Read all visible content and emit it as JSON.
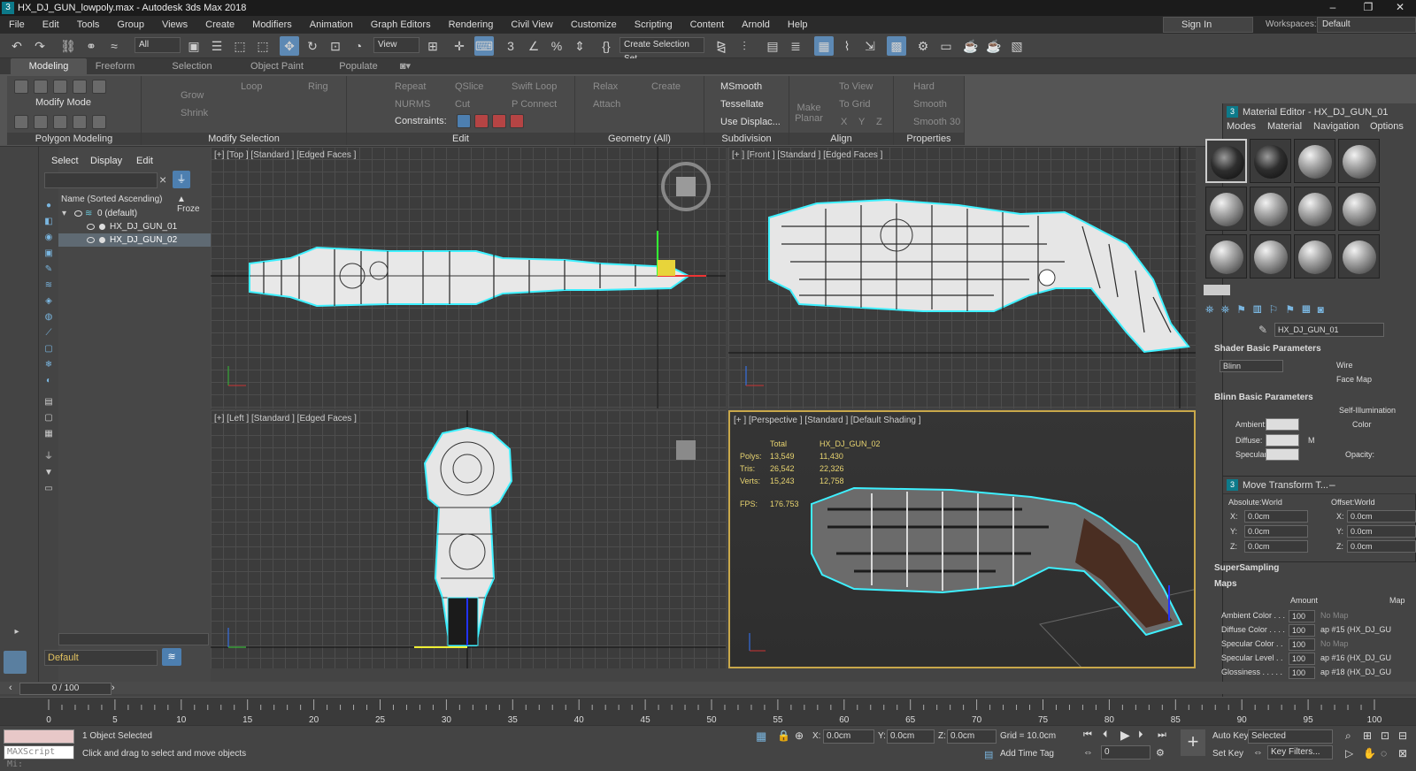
{
  "title": "HX_DJ_GUN_lowpoly.max - Autodesk 3ds Max 2018",
  "menu": [
    "File",
    "Edit",
    "Tools",
    "Group",
    "Views",
    "Create",
    "Modifiers",
    "Animation",
    "Graph Editors",
    "Rendering",
    "Civil View",
    "Customize",
    "Scripting",
    "Content",
    "Arnold",
    "Help"
  ],
  "signin": "Sign In",
  "workspaces_label": "Workspaces:",
  "workspaces_value": "Default",
  "toolbar": {
    "filter": "All",
    "view": "View",
    "selset": "Create Selection Set"
  },
  "ribbon_tabs": [
    "Modeling",
    "Freeform",
    "Selection",
    "Object Paint",
    "Populate"
  ],
  "ribbon": {
    "modify_mode": "Modify Mode",
    "poly": "Polygon Modeling",
    "grow": "Grow",
    "shrink": "Shrink",
    "loop": "Loop",
    "ring": "Ring",
    "modsel": "Modify Selection",
    "repeat": "Repeat",
    "qslice": "QSlice",
    "swiftloop": "Swift Loop",
    "nurms": "NURMS",
    "cut": "Cut",
    "pconnect": "P Connect",
    "constraints": "Constraints:",
    "edit": "Edit",
    "relax": "Relax",
    "create": "Create",
    "attach": "Attach",
    "geometry": "Geometry (All)",
    "msmooth": "MSmooth",
    "tessellate": "Tessellate",
    "usedisplac": "Use Displac...",
    "subdivision": "Subdivision",
    "makeplanar": "Make Planar",
    "align": "Align",
    "x": "X",
    "y": "Y",
    "z": "Z",
    "toview": "To View",
    "togrid": "To Grid",
    "hard": "Hard",
    "smooth": "Smooth",
    "smooth30": "Smooth 30",
    "properties": "Properties"
  },
  "scene": {
    "tabs": [
      "Select",
      "Display",
      "Edit"
    ],
    "col": "Name (Sorted Ascending)",
    "froze": "▲ Froze",
    "layer": "0 (default)",
    "items": [
      "HX_DJ_GUN_01",
      "HX_DJ_GUN_02"
    ],
    "layer_bottom": "Default"
  },
  "viewports": {
    "top": "[+] [Top ] [Standard ] [Edged Faces ]",
    "front": "[+ ] [Front ] [Standard ] [Edged Faces ]",
    "left": "[+] [Left ] [Standard ] [Edged Faces ]",
    "persp": "[+ ] [Perspective ] [Standard ] [Default Shading ]"
  },
  "stats": {
    "total": "Total",
    "obj": "HX_DJ_GUN_02",
    "polys": "Polys:",
    "tris": "Tris:",
    "verts": "Verts:",
    "polys_t": "13,549",
    "polys_o": "11,430",
    "tris_t": "26,542",
    "tris_o": "22,326",
    "verts_t": "15,243",
    "verts_o": "12,758",
    "fps": "FPS:",
    "fps_v": "176.753"
  },
  "mat": {
    "title": "Material Editor - HX_DJ_GUN_01",
    "menu": [
      "Modes",
      "Material",
      "Navigation",
      "Options"
    ],
    "name": "HX_DJ_GUN_01",
    "shader_hdr": "Shader Basic Parameters",
    "shader": "Blinn",
    "wire": "Wire",
    "facemap": "Face Map",
    "blinn_hdr": "Blinn Basic Parameters",
    "selfillum": "Self-Illumination",
    "color": "Color",
    "ambient": "Ambient:",
    "diffuse": "Diffuse:",
    "specular": "Specular:",
    "opacity": "Opacity:",
    "m": "M",
    "supersampling": "SuperSampling",
    "maps": "Maps",
    "amount": "Amount",
    "map": "Map",
    "maprows": [
      {
        "label": "Ambient Color . . .",
        "amt": "100",
        "map": "No Map"
      },
      {
        "label": "Diffuse Color . . . .",
        "amt": "100",
        "map": "ap #15 (HX_DJ_GU"
      },
      {
        "label": "Specular Color . .",
        "amt": "100",
        "map": "No Map"
      },
      {
        "label": "Specular Level . .",
        "amt": "100",
        "map": "ap #16 (HX_DJ_GU"
      },
      {
        "label": "Glossiness . . . . .",
        "amt": "100",
        "map": "ap #18 (HX_DJ_GU"
      }
    ]
  },
  "movet": {
    "title": "Move Transform T...",
    "abs": "Absolute:World",
    "off": "Offset:World",
    "x": "X:",
    "y": "Y:",
    "z": "Z:",
    "v": "0.0cm"
  },
  "timeline": {
    "pos": "0 / 100",
    "ticks": [
      "0",
      "5",
      "10",
      "15",
      "20",
      "25",
      "30",
      "35",
      "40",
      "45",
      "50",
      "55",
      "60",
      "65",
      "70",
      "75",
      "80",
      "85",
      "90",
      "95",
      "100"
    ]
  },
  "status": {
    "maxscript": "MAXScript Mi:",
    "selected": "1 Object Selected",
    "hint": "Click and drag to select and move objects",
    "x": "X:",
    "y": "Y:",
    "z": "Z:",
    "xv": "0.0cm",
    "yv": "0.0cm",
    "zv": "0.0cm",
    "grid": "Grid = 10.0cm",
    "addtime": "Add Time Tag",
    "autokey": "Auto Key",
    "setkey": "Set Key",
    "sel": "Selected",
    "keyfilters": "Key Filters...",
    "frame": "0"
  }
}
